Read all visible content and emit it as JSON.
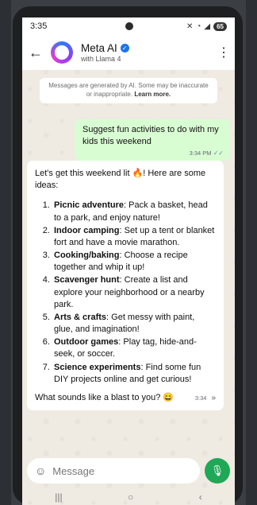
{
  "status_bar": {
    "time": "3:35",
    "battery": "65"
  },
  "header": {
    "name": "Meta AI",
    "subtitle": "with Llama 4"
  },
  "notice": {
    "text": "Messages are generated by AI. Some may be inaccurate or inappropriate.",
    "link": "Learn more."
  },
  "outgoing": {
    "text": "Suggest fun activities to do with my kids this weekend",
    "time": "3:34 PM"
  },
  "incoming": {
    "intro": "Let's get this weekend lit 🔥! Here are some ideas:",
    "items": [
      {
        "title": "Picnic adventure",
        "desc": ": Pack a basket, head to a park, and enjoy nature!"
      },
      {
        "title": "Indoor camping",
        "desc": ": Set up a tent or blanket fort and have a movie marathon."
      },
      {
        "title": "Cooking/baking",
        "desc": ": Choose a recipe together and whip it up!"
      },
      {
        "title": "Scavenger hunt",
        "desc": ": Create a list and explore your neighborhood or a nearby park."
      },
      {
        "title": "Arts & crafts",
        "desc": ": Get messy with paint, glue, and imagination!"
      },
      {
        "title": "Outdoor games",
        "desc": ": Play tag, hide-and-seek, or soccer."
      },
      {
        "title": "Science experiments",
        "desc": ": Find some fun DIY projects online and get curious!"
      }
    ],
    "closing": "What sounds like a blast to you? 😄",
    "time": "3:34"
  },
  "composer": {
    "placeholder": "Message"
  },
  "icons": {
    "back": "arrow-left-icon",
    "menu": "kebab-menu-icon",
    "emoji": "emoji-icon",
    "mic": "mic-icon",
    "scroll_down": "chevron-double-down-icon"
  },
  "colors": {
    "outgoing_bubble": "#d9fdd3",
    "mic_button": "#1fa855",
    "verified": "#1d74e8"
  }
}
